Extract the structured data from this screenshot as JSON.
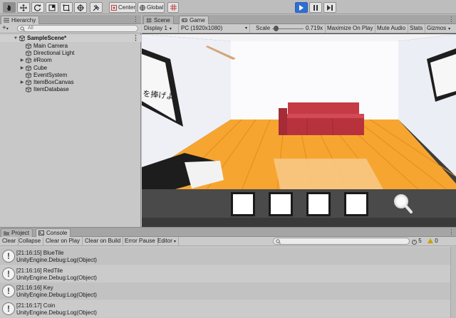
{
  "toolbar": {
    "pivot_label": "Center",
    "space_label": "Global",
    "accent_color": "#2f6fd4"
  },
  "hierarchy": {
    "tab_label": "Hierarchy",
    "add_label": "+",
    "search_placeholder": "All",
    "scene_name": "SampleScene*",
    "items": [
      {
        "label": "Main Camera",
        "expandable": false
      },
      {
        "label": "Directional Light",
        "expandable": false
      },
      {
        "label": "#Room",
        "expandable": true
      },
      {
        "label": "Cube",
        "expandable": true
      },
      {
        "label": "EventSystem",
        "expandable": false
      },
      {
        "label": "ItemBoxCanvas",
        "expandable": true
      },
      {
        "label": "ItemDatabase",
        "expandable": false
      }
    ]
  },
  "game_view": {
    "tabs": [
      {
        "label": "Scene",
        "icon": "grid-icon"
      },
      {
        "label": "Game",
        "icon": "gamepad-icon"
      }
    ],
    "display_label": "Display 1",
    "resolution_label": "PC (1920x1080)",
    "scale_label": "Scale",
    "scale_value": "0.719x",
    "scale_level": 0.12,
    "maximize_label": "Maximize On Play",
    "mute_label": "Mute Audio",
    "stats_label": "Stats",
    "gizmos_label": "Gizmos",
    "wall_text": "を捧げよ",
    "item_slots": 4
  },
  "bottom_panel": {
    "tabs": [
      {
        "label": "Project",
        "icon": "folder-icon"
      },
      {
        "label": "Console",
        "icon": "console-icon"
      }
    ],
    "tools": {
      "clear": "Clear",
      "collapse": "Collapse",
      "clear_on_play": "Clear on Play",
      "clear_on_build": "Clear on Build",
      "error_pause": "Error Pause",
      "editor": "Editor"
    },
    "message_count": "5",
    "warning_count": "0",
    "logs": [
      {
        "line1": "[21:16:15] BlueTile",
        "line2": "UnityEngine.Debug:Log(Object)"
      },
      {
        "line1": "[21:16:16] RedTile",
        "line2": "UnityEngine.Debug:Log(Object)"
      },
      {
        "line1": "[21:16:16] Key",
        "line2": "UnityEngine.Debug:Log(Object)"
      },
      {
        "line1": "[21:16:17] Coin",
        "line2": "UnityEngine.Debug:Log(Object)"
      }
    ]
  }
}
